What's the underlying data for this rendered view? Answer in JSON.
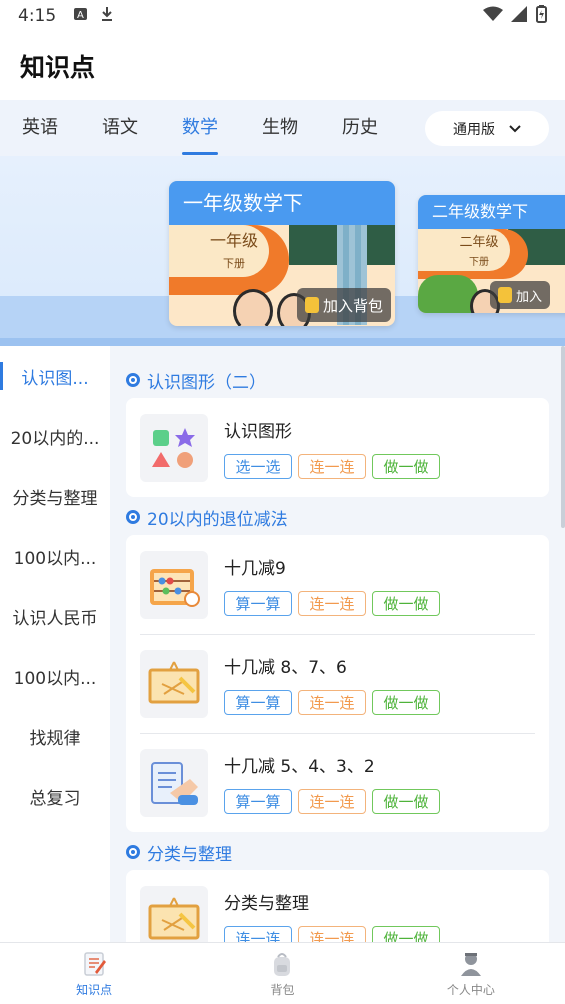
{
  "status": {
    "time": "4:15"
  },
  "appbar": {
    "title": "知识点"
  },
  "tabs": [
    {
      "label": "英语"
    },
    {
      "label": "语文"
    },
    {
      "label": "数学"
    },
    {
      "label": "生物"
    },
    {
      "label": "历史"
    }
  ],
  "version": {
    "label": "通用版"
  },
  "banner": {
    "books": [
      {
        "title": "一年级数学下",
        "cover_grade": "一年级",
        "cover_volume": "下册",
        "add_label": "加入背包"
      },
      {
        "title": "二年级数学下",
        "cover_grade": "二年级",
        "cover_volume": "下册",
        "add_label": "加入"
      }
    ]
  },
  "sidebar": {
    "items": [
      {
        "label": "认识图..."
      },
      {
        "label": "20以内的..."
      },
      {
        "label": "分类与整理"
      },
      {
        "label": "100以内..."
      },
      {
        "label": "认识人民币"
      },
      {
        "label": "100以内..."
      },
      {
        "label": "找规律"
      },
      {
        "label": "总复习"
      }
    ]
  },
  "sections": [
    {
      "title": "认识图形（二）",
      "lessons": [
        {
          "name": "认识图形",
          "buttons": [
            "选一选",
            "连一连",
            "做一做"
          ]
        }
      ]
    },
    {
      "title": "20以内的退位减法",
      "lessons": [
        {
          "name": "十几减9",
          "buttons": [
            "算一算",
            "连一连",
            "做一做"
          ]
        },
        {
          "name": "十几减 8、7、6",
          "buttons": [
            "算一算",
            "连一连",
            "做一做"
          ]
        },
        {
          "name": "十几减 5、4、3、2",
          "buttons": [
            "算一算",
            "连一连",
            "做一做"
          ]
        }
      ]
    },
    {
      "title": "分类与整理",
      "lessons": [
        {
          "name": "分类与整理",
          "buttons": [
            "连一连",
            "连一连",
            "做一做"
          ]
        }
      ]
    }
  ],
  "bottomnav": [
    {
      "label": "知识点"
    },
    {
      "label": "背包"
    },
    {
      "label": "个人中心"
    }
  ],
  "colors": {
    "accent": "#2f7be0",
    "blue_btn": "#3f8ee3",
    "orange_btn": "#f29a4e",
    "green_btn": "#4eb33a"
  }
}
